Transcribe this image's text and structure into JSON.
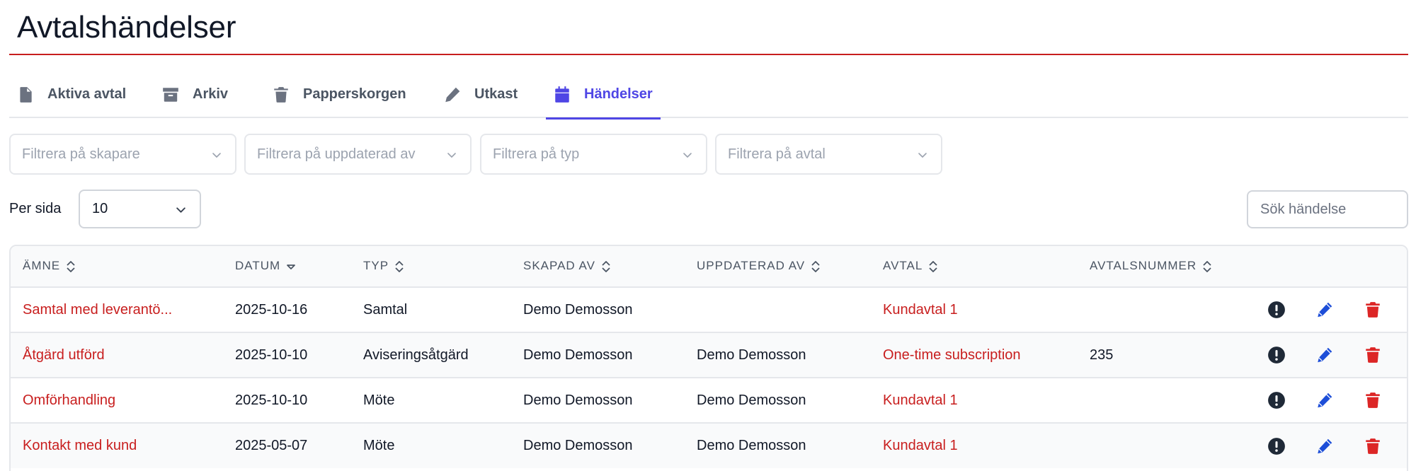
{
  "page": {
    "title": "Avtalshändelser"
  },
  "tabs": [
    {
      "label": "Aktiva avtal",
      "icon": "file-icon",
      "active": false
    },
    {
      "label": "Arkiv",
      "icon": "archive-icon",
      "active": false
    },
    {
      "label": "Papperskorgen",
      "icon": "trash-icon",
      "active": false
    },
    {
      "label": "Utkast",
      "icon": "pencil-icon",
      "active": false
    },
    {
      "label": "Händelser",
      "icon": "calendar-icon",
      "active": true
    }
  ],
  "filters": [
    {
      "placeholder": "Filtrera på skapare"
    },
    {
      "placeholder": "Filtrera på uppdaterad av"
    },
    {
      "placeholder": "Filtrera på typ"
    },
    {
      "placeholder": "Filtrera på avtal"
    }
  ],
  "pagination": {
    "label": "Per sida",
    "value": "10"
  },
  "search": {
    "placeholder": "Sök händelse"
  },
  "table": {
    "columns": [
      "Ämne",
      "Datum",
      "Typ",
      "Skapad av",
      "Uppdaterad av",
      "Avtal",
      "Avtalsnummer"
    ],
    "sort": {
      "column": "Datum",
      "direction": "desc"
    },
    "rows": [
      {
        "subject": "Samtal med leverantö...",
        "date": "2025-10-16",
        "type": "Samtal",
        "created_by": "Demo Demosson",
        "updated_by": "",
        "agreement": "Kundavtal 1",
        "agreement_number": ""
      },
      {
        "subject": "Åtgärd utförd",
        "date": "2025-10-10",
        "type": "Aviseringsåtgärd",
        "created_by": "Demo Demosson",
        "updated_by": "Demo Demosson",
        "agreement": "One-time subscription",
        "agreement_number": "235"
      },
      {
        "subject": "Omförhandling",
        "date": "2025-10-10",
        "type": "Möte",
        "created_by": "Demo Demosson",
        "updated_by": "Demo Demosson",
        "agreement": "Kundavtal 1",
        "agreement_number": ""
      },
      {
        "subject": "Kontakt med kund",
        "date": "2025-05-07",
        "type": "Möte",
        "created_by": "Demo Demosson",
        "updated_by": "Demo Demosson",
        "agreement": "Kundavtal 1",
        "agreement_number": ""
      }
    ],
    "row_actions": [
      "info-icon",
      "edit-icon",
      "delete-icon"
    ]
  },
  "colors": {
    "accent": "#4f46e5",
    "brand_red": "#c81e1e",
    "edit_blue": "#1d4ed8",
    "delete_red": "#dc2626"
  }
}
